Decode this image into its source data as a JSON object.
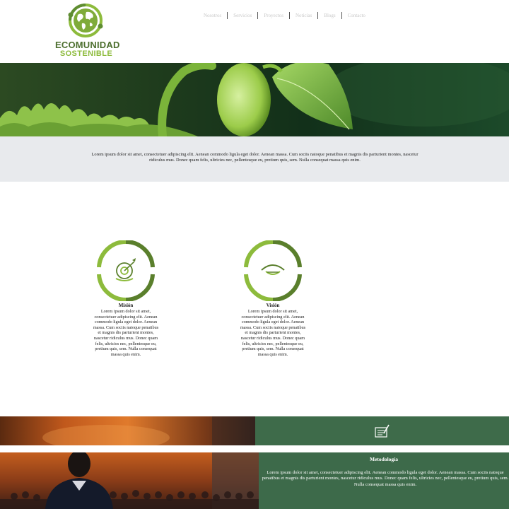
{
  "logo": {
    "line1": "ECOMUNIDAD",
    "line2": "SOSTENIBLE"
  },
  "nav": {
    "items": [
      "Nosotros",
      "Servicios",
      "Proyectos",
      "Noticias",
      "Blogs",
      "Contacto"
    ]
  },
  "intro": {
    "text": "Lorem ipsum dolor sit amet, consectetuer adipiscing elit. Aenean commodo ligula eget dolor. Aenean massa. Cum sociis natoque penatibus et magnis dis parturient montes, nascetur ridiculus mus. Donec quam felis, ultricies nec, pellentesque eu, pretium quis, sem. Nulla consequat massa quis enim."
  },
  "mision": {
    "title": "Misión",
    "icon": "target-icon",
    "text": "Lorem ipsum dolor sit amet, consectetuer adipiscing elit. Aenean commodo ligula eget dolor. Aenean massa. Cum sociis natoque penatibus et magnis dis parturient montes, nascetur ridiculus mus. Donec quam felis, ultricies nec, pellentesque eu, pretium quis, sem. Nulla consequat massa quis enim."
  },
  "vision": {
    "title": "Visión",
    "icon": "eye-icon",
    "text": "Lorem ipsum dolor sit amet, consectetuer adipiscing elit. Aenean commodo ligula eget dolor. Aenean massa. Cum sociis natoque penatibus et magnis dis parturient montes, nascetur ridiculus mus. Donec quam felis, ultricies nec, pellentesque eu, pretium quis, sem. Nulla consequat massa quis enim."
  },
  "metodologia": {
    "title": "Metodología",
    "icon": "document-pen-icon",
    "text": "Lorem ipsum dolor sit amet, consectetuer adipiscing elit. Aenean commodo ligula eget dolor. Aenean massa. Cum sociis natoque penatibus et magnis dis parturient montes, nascetur ridiculus mus. Donec quam felis, ultricies nec, pellentesque eu, pretium quis, sem. Nulla consequat massa quis enim."
  },
  "colors": {
    "green_dark": "#4d6f2f",
    "green_light": "#8dbb3c",
    "band_green": "#3e6b4a",
    "intro_bg": "#e8eaed"
  }
}
